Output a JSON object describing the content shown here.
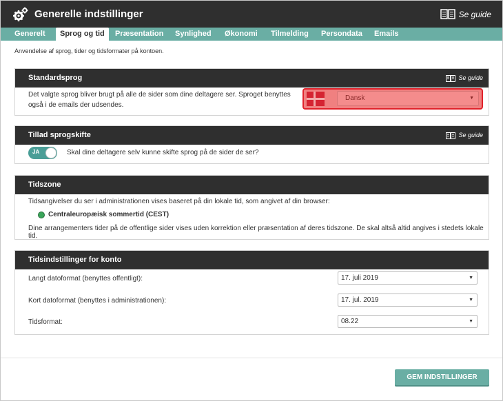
{
  "header": {
    "title": "Generelle indstillinger",
    "guide_label": "Se guide"
  },
  "tabs": [
    {
      "label": "Generelt"
    },
    {
      "label": "Sprog og tid",
      "active": true
    },
    {
      "label": "Præsentation"
    },
    {
      "label": "Synlighed"
    },
    {
      "label": "Økonomi"
    },
    {
      "label": "Tilmelding"
    },
    {
      "label": "Persondata"
    },
    {
      "label": "Emails"
    }
  ],
  "page_description": "Anvendelse af sprog, tider og tidsformater på kontoen.",
  "standard_language": {
    "title": "Standardsprog",
    "guide_label": "Se guide",
    "description": "Det valgte sprog bliver brugt på alle de sider som dine deltagere ser. Sproget benyttes også i de emails der udsendes.",
    "selected_language": "Dansk"
  },
  "language_switch": {
    "title": "Tillad sprogskifte",
    "guide_label": "Se guide",
    "toggle_label": "JA",
    "toggle_on": true,
    "question": "Skal dine deltagere selv kunne skifte sprog på de sider de ser?"
  },
  "timezone": {
    "title": "Tidszone",
    "line1": "Tidsangivelser du ser i administrationen vises baseret på din lokale tid, som angivet af din browser:",
    "zone_name": "Centraleuropæisk sommertid (CEST)",
    "line2": "Dine arrangementers tider på de offentlige sider vises uden korrektion eller præsentation af deres tidszone. De skal altså altid angives i stedets lokale tid."
  },
  "time_settings": {
    "title": "Tidsindstillinger for konto",
    "rows": [
      {
        "label": "Langt datoformat (benyttes offentligt):",
        "value": "17. juli 2019"
      },
      {
        "label": "Kort datoformat (benyttes i administrationen):",
        "value": "17. jul. 2019"
      },
      {
        "label": "Tidsformat:",
        "value": "08.22"
      }
    ]
  },
  "save_button_label": "GEM INDSTILLINGER",
  "colors": {
    "header_bg": "#2f2f2f",
    "accent": "#6aaea4",
    "highlight": "#e0222b"
  }
}
